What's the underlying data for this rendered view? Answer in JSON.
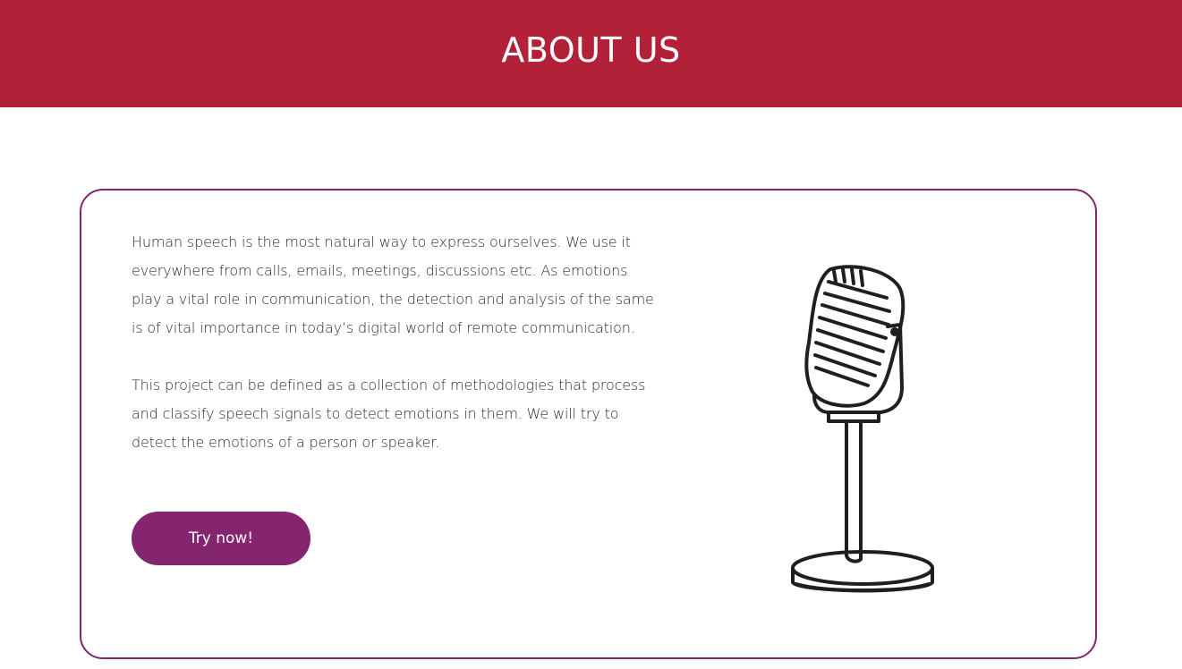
{
  "header": {
    "title": "ABOUT US",
    "background_color": "#b22138"
  },
  "about": {
    "paragraph_1": "Human speech is the most natural way to express ourselves. We use it everywhere from calls, emails, meetings, discussions etc. As emotions play a vital role in communication, the detection and analysis of the same is of vital importance in today’s digital world of remote communication.",
    "paragraph_2": "This project can be defined as a collection of methodologies that process and classify speech signals to detect emotions in them. We will try to detect the emotions of a person or speaker.",
    "cta_label": "Try now!",
    "accent_color": "#852570",
    "illustration": "microphone-icon"
  }
}
